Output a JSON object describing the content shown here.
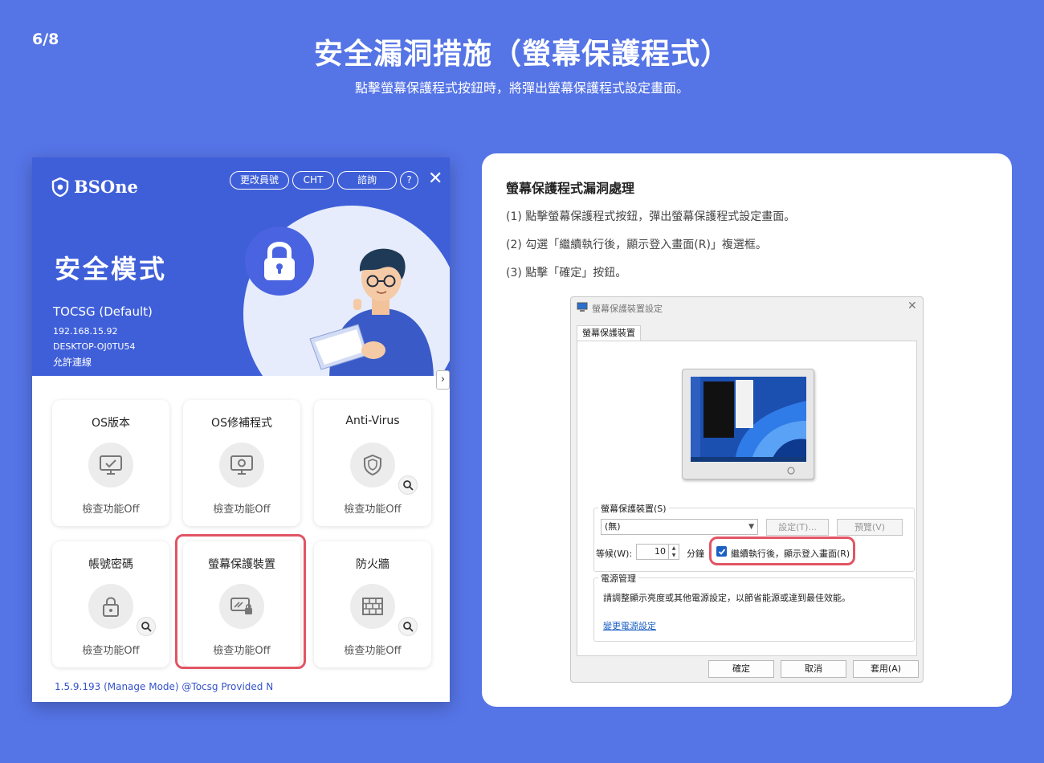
{
  "slide": {
    "page_number": "6/8",
    "title": "安全漏洞措施（螢幕保護程式）",
    "subtitle": "點擊螢幕保護程式按鈕時，將彈出螢幕保護程式設定畫面。"
  },
  "bsone": {
    "logo_text": "BSOne",
    "top_buttons": [
      "更改員號",
      "CHT",
      "諮詢"
    ],
    "help_label": "?",
    "close_label": "✕",
    "mode_title": "安全模式",
    "profile": "TOCSG (Default)",
    "ip": "192.168.15.92",
    "hostname": "DESKTOP-OJ0TU54",
    "connection": "允許連線",
    "expand_label": "›",
    "cards": [
      {
        "title": "OS版本",
        "status": "檢查功能Off",
        "icon": "monitor-check-icon"
      },
      {
        "title": "OS修補程式",
        "status": "檢查功能Off",
        "icon": "monitor-gear-icon"
      },
      {
        "title": "Anti-Virus",
        "status": "檢查功能Off",
        "icon": "shield-icon"
      },
      {
        "title": "帳號密碼",
        "status": "檢查功能Off",
        "icon": "lock-icon"
      },
      {
        "title": "螢幕保護裝置",
        "status": "檢查功能Off",
        "icon": "screensaver-icon"
      },
      {
        "title": "防火牆",
        "status": "檢查功能Off",
        "icon": "firewall-icon"
      }
    ],
    "footer": "1.5.9.193 (Manage Mode) @Tocsg Provided N"
  },
  "panel": {
    "title": "螢幕保護程式漏洞處理",
    "steps": [
      "(1) 點擊螢幕保護程式按鈕，彈出螢幕保護程式設定畫面。",
      "(2) 勾選「繼續執行後，顯示登入畫面(R)」複選框。",
      "(3) 點擊「確定」按鈕。"
    ]
  },
  "dialog": {
    "title": "螢幕保護裝置設定",
    "tab": "螢幕保護裝置",
    "group_saver": "螢幕保護裝置(S)",
    "saver_value": "(無)",
    "settings_button": "設定(T)...",
    "preview_button": "預覽(V)",
    "wait_label": "等候(W):",
    "wait_value": "10",
    "minutes_label": "分鐘",
    "resume_checkbox": "繼續執行後，顯示登入畫面(R)",
    "resume_checked": true,
    "group_power": "電源管理",
    "power_text": "請調整顯示亮度或其他電源設定，以節省能源或達到最佳效能。",
    "power_link": "變更電源設定",
    "ok_button": "確定",
    "cancel_button": "取消",
    "apply_button": "套用(A)"
  },
  "colors": {
    "background": "#5574e6",
    "bsone_header": "#3f5fd9",
    "highlight": "#e25565",
    "link": "#1a5fc4"
  }
}
